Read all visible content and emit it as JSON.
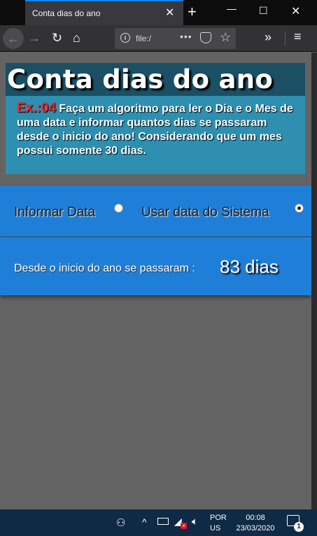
{
  "browser": {
    "tab_title": "Conta dias do ano",
    "tab_close": "✕",
    "new_tab": "+",
    "url": "file:/",
    "url_dots": "•••",
    "window_min": "—",
    "window_max": "☐",
    "window_close": "✕"
  },
  "page": {
    "title": "Conta dias do ano",
    "exercise_label": "Ex.:04",
    "description": " Faça um algoritmo para ler o Dia e o Mes de uma data e informar quantos dias se passaram desde o inicio do ano! Considerando que um mes possui somente 30 dias.",
    "options": [
      {
        "label": "Informar Data",
        "selected": false
      },
      {
        "label": "Usar data do Sistema",
        "selected": true
      }
    ],
    "result_label": "Desde o inicio do ano se passaram :",
    "result_value": "83 dias"
  },
  "taskbar": {
    "language_line1": "POR",
    "language_line2": "US",
    "time": "00:08",
    "date": "23/03/2020",
    "notification_count": "1"
  },
  "colors": {
    "title_band": "#1b4f64",
    "header_box": "#2e8fb0",
    "accent_blue": "#1f7fd8",
    "exercise_red": "#ff2020",
    "page_bg": "#636363"
  }
}
